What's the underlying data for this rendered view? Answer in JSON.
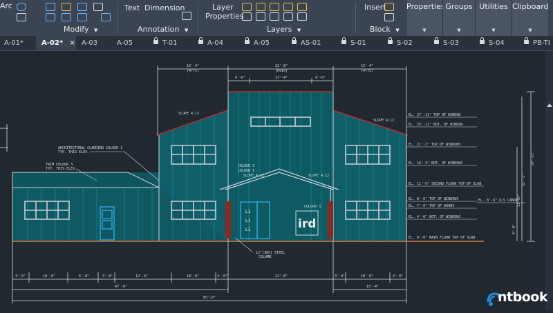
{
  "ribbon": {
    "arc_label": "Arc",
    "modify_label": "Modify",
    "text_label": "Text",
    "dimension_label": "Dimension",
    "annotation_label": "Annotation",
    "layer_properties_line1": "Layer",
    "layer_properties_line2": "Properties",
    "layers_label": "Layers",
    "insert_label": "Insert",
    "block_label": "Block",
    "properties_label": "Properties",
    "groups_label": "Groups",
    "utilities_label": "Utilities",
    "clipboard_label": "Clipboard",
    "dropdown_glyph": "▼"
  },
  "tabs": [
    {
      "label": "A-01*",
      "locked": false,
      "active": false
    },
    {
      "label": "A-02*",
      "locked": false,
      "active": true,
      "close": "×"
    },
    {
      "label": "A-03",
      "locked": false,
      "active": false
    },
    {
      "label": "A-05",
      "locked": false,
      "active": false
    },
    {
      "label": "T-01",
      "locked": true,
      "active": false
    },
    {
      "label": "A-04",
      "locked": true,
      "active": false
    },
    {
      "label": "A-05",
      "locked": true,
      "active": false
    },
    {
      "label": "AS-01",
      "locked": true,
      "active": false
    },
    {
      "label": "S-01",
      "locked": true,
      "active": false
    },
    {
      "label": "S-02",
      "locked": true,
      "active": false
    },
    {
      "label": "S-03",
      "locked": true,
      "active": false
    },
    {
      "label": "S-04",
      "locked": true,
      "active": false
    },
    {
      "label": "PB-TI",
      "locked": true,
      "active": false
    }
  ],
  "drawing": {
    "dim_top": [
      "15'-4\"",
      "22'-8\"",
      "15'-4\""
    ],
    "dim_top_sub": [
      "[4775]",
      "[6910]",
      "[4775]"
    ],
    "dim_second": [
      "4'-6\"",
      "17'-4\"",
      "4'-6\""
    ],
    "slope_left": "SLOPE 4:12",
    "slope_right": "SLOPE 4:12",
    "slope_center_left": "SLOPE 4:12",
    "slope_center_right": "SLOPE 4:12",
    "note_cladding": "ARCHITECTURAL CLADDING COLOUR 1",
    "note_cladding_sub": "TYP. THIS ELEV.",
    "note_trim": "TRIM COLOUR 3",
    "note_trim_sub": "TYP. THIS ELEV.",
    "note_colour3": "COLOUR 3",
    "note_colour1": "COLOUR 1",
    "note_steel": "12\"[305] STEEL",
    "note_steel_sub": "COLUMN",
    "elevations": [
      "EL. 27'-11\"  TOP OF WINDOW",
      "EL. 25'-11\"  BOT. OF WINDOW",
      "EL. 21'-3\"  TOP OF WINDOWS",
      "EL. 16'-3\"  BOT. OF WINDOWS",
      "EL. 11'-9\"  SECOND FLOOR TOP OF SLAB",
      "EL. 8'-0\"  TOP OF WINDOWS",
      "EL. 7'-0\"  TOP OF DOORS",
      "EL. 4'-0\"  BOT. OF WINDOWS",
      "EL. 0'-0\"  MAIN FLOOR TOP OF SLAB"
    ],
    "canopy_note": "EL. 8'-6\"  U/S CANOPY",
    "bottom_dims": [
      "3'-0\"",
      "10'-0\"",
      "6'-8\"",
      "3'-4\"",
      "12'-4\"",
      "10'-0\"",
      "3'-0\"",
      "22'-8\"",
      "3'-0\"",
      "10'-0\"",
      "3'-0\""
    ],
    "bottom_total_left": "47'-0\"",
    "bottom_total_right": "15'-4\"",
    "bottom_overall": "85'-0\"",
    "door_labels": [
      "L1",
      "L1",
      "L1"
    ],
    "sign_text": "ird",
    "right_dims": [
      "27'-11\"",
      "21'-3\"",
      "11'-9\"",
      "4'-0\""
    ]
  },
  "watermark": {
    "brand": "ntbook"
  },
  "colors": {
    "ribbon_bg": "#3b4453",
    "canvas_bg": "#212830",
    "cladding": "#0f7f86",
    "roof_trim": "#b03030",
    "window": "#c8ced6",
    "dimension": "#d8dde4",
    "brand": "#1e8fe0"
  }
}
